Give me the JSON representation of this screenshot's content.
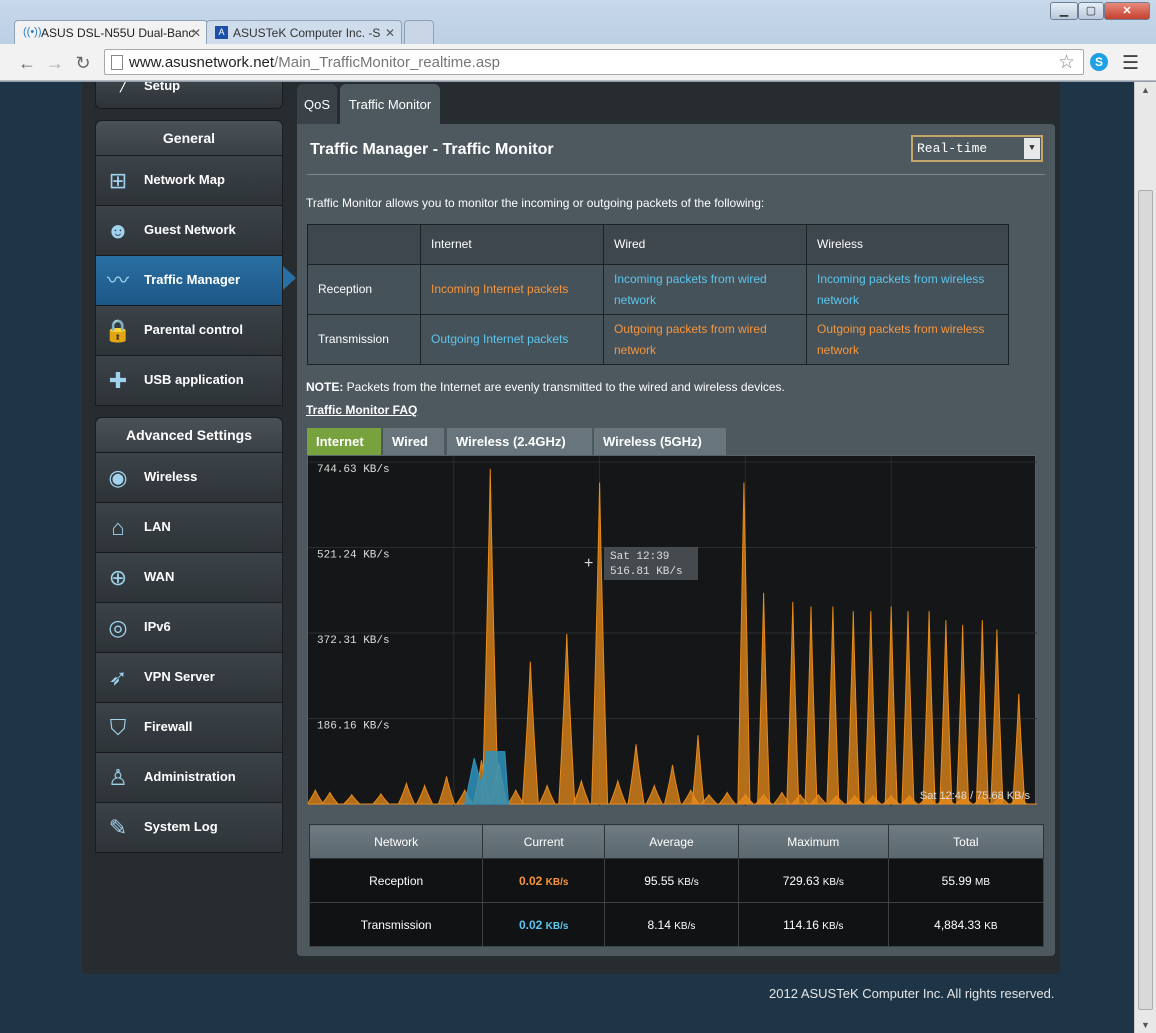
{
  "browser": {
    "tabs": [
      {
        "title": "ASUS DSL-N55U Dual-Banc"
      },
      {
        "title": "ASUSTeK Computer Inc. -S"
      }
    ],
    "url_host": "www.asusnetwork.net",
    "url_path": "/Main_TrafficMonitor_realtime.asp"
  },
  "sidebar": {
    "setup_label": "Setup",
    "general_header": "General",
    "general_items": [
      {
        "label": "Network Map",
        "icon": "network-map-icon"
      },
      {
        "label": "Guest Network",
        "icon": "guest-network-icon"
      },
      {
        "label": "Traffic Manager",
        "icon": "traffic-manager-icon",
        "active": true
      },
      {
        "label": "Parental control",
        "icon": "lock-icon"
      },
      {
        "label": "USB application",
        "icon": "puzzle-icon"
      }
    ],
    "advanced_header": "Advanced Settings",
    "advanced_items": [
      {
        "label": "Wireless",
        "icon": "wifi-icon"
      },
      {
        "label": "LAN",
        "icon": "home-icon"
      },
      {
        "label": "WAN",
        "icon": "globe-icon"
      },
      {
        "label": "IPv6",
        "icon": "ipv6-icon"
      },
      {
        "label": "VPN Server",
        "icon": "vpn-icon"
      },
      {
        "label": "Firewall",
        "icon": "shield-icon"
      },
      {
        "label": "Administration",
        "icon": "admin-icon"
      },
      {
        "label": "System Log",
        "icon": "log-icon"
      }
    ]
  },
  "main_tabs": [
    {
      "label": "QoS"
    },
    {
      "label": "Traffic Monitor"
    }
  ],
  "content": {
    "title": "Traffic Manager - Traffic Monitor",
    "mode_select": "Real-time",
    "description": "Traffic Monitor allows you to monitor the incoming or outgoing packets of the following:",
    "info_table": {
      "headers": [
        "",
        "Internet",
        "Wired",
        "Wireless"
      ],
      "rows": [
        {
          "label": "Reception",
          "cells": [
            "Incoming Internet packets",
            "Incoming packets from wired network",
            "Incoming packets from wireless network"
          ]
        },
        {
          "label": "Transmission",
          "cells": [
            "Outgoing Internet packets",
            "Outgoing packets from wired network",
            "Outgoing packets from wireless network"
          ]
        }
      ]
    },
    "note_bold": "NOTE:",
    "note_text": " Packets from the Internet are evenly transmitted to the wired and wireless devices.",
    "faq_link": "Traffic Monitor FAQ",
    "graph_tabs": [
      {
        "label": "Internet"
      },
      {
        "label": "Wired"
      },
      {
        "label": "Wireless (2.4GHz)"
      },
      {
        "label": "Wireless (5GHz)"
      }
    ],
    "tooltip": {
      "time": "Sat 12:39",
      "value": "516.81 KB/s"
    },
    "graph_footer": "Sat 12:48 / 75.68 KB/s"
  },
  "chart_data": {
    "type": "area",
    "y_tick_labels": [
      "744.63 KB/s",
      "521.24 KB/s",
      "372.31 KB/s",
      "186.16 KB/s"
    ],
    "y_ticks": [
      744.63,
      558.47,
      372.31,
      186.16
    ],
    "ylim": [
      0,
      744.63
    ],
    "grid": true,
    "series": [
      {
        "color": "#e98b1a",
        "peaks": [
          [
            0.01,
            30
          ],
          [
            0.03,
            25
          ],
          [
            0.06,
            20
          ],
          [
            0.1,
            22
          ],
          [
            0.135,
            45
          ],
          [
            0.16,
            40
          ],
          [
            0.19,
            60
          ],
          [
            0.215,
            30
          ],
          [
            0.238,
            95
          ],
          [
            0.25,
            729.63
          ],
          [
            0.262,
            90
          ],
          [
            0.285,
            30
          ],
          [
            0.305,
            310
          ],
          [
            0.328,
            40
          ],
          [
            0.355,
            370
          ],
          [
            0.375,
            50
          ],
          [
            0.4,
            700
          ],
          [
            0.425,
            50
          ],
          [
            0.45,
            130
          ],
          [
            0.475,
            40
          ],
          [
            0.5,
            85
          ],
          [
            0.525,
            30
          ],
          [
            0.55,
            20
          ],
          [
            0.575,
            25
          ],
          [
            0.6,
            20
          ],
          [
            0.625,
            20
          ],
          [
            0.65,
            25
          ],
          [
            0.675,
            20
          ],
          [
            0.7,
            20
          ],
          [
            0.725,
            18
          ],
          [
            0.75,
            18
          ],
          [
            0.775,
            18
          ],
          [
            0.8,
            18
          ],
          [
            0.825,
            18
          ],
          [
            0.85,
            18
          ],
          [
            0.875,
            18
          ],
          [
            0.9,
            18
          ],
          [
            0.925,
            18
          ],
          [
            0.95,
            18
          ],
          [
            0.975,
            18
          ]
        ]
      },
      {
        "color": "#2e93bd",
        "peaks": [
          [
            0.228,
            100
          ],
          [
            0.258,
            114.16
          ]
        ]
      }
    ],
    "late_spikes": [
      [
        0.535,
        150
      ],
      [
        0.598,
        700
      ],
      [
        0.625,
        460
      ],
      [
        0.665,
        440
      ],
      [
        0.69,
        430
      ],
      [
        0.72,
        430
      ],
      [
        0.748,
        420
      ],
      [
        0.772,
        420
      ],
      [
        0.8,
        430
      ],
      [
        0.823,
        420
      ],
      [
        0.852,
        420
      ],
      [
        0.875,
        400
      ],
      [
        0.898,
        390
      ],
      [
        0.925,
        400
      ],
      [
        0.945,
        380
      ],
      [
        0.975,
        240
      ]
    ]
  },
  "stats": {
    "headers": [
      "Network",
      "Current",
      "Average",
      "Maximum",
      "Total"
    ],
    "rows": [
      {
        "network": "Reception",
        "current": "0.02",
        "current_unit": "KB/s",
        "average": "95.55",
        "average_unit": "KB/s",
        "maximum": "729.63",
        "maximum_unit": "KB/s",
        "total": "55.99",
        "total_unit": "MB"
      },
      {
        "network": "Transmission",
        "current": "0.02",
        "current_unit": "KB/s",
        "average": "8.14",
        "average_unit": "KB/s",
        "maximum": "114.16",
        "maximum_unit": "KB/s",
        "total": "4,884.33",
        "total_unit": "KB"
      }
    ]
  },
  "footer": {
    "copyright": "2012 ASUSTeK Computer Inc. All rights reserved."
  }
}
